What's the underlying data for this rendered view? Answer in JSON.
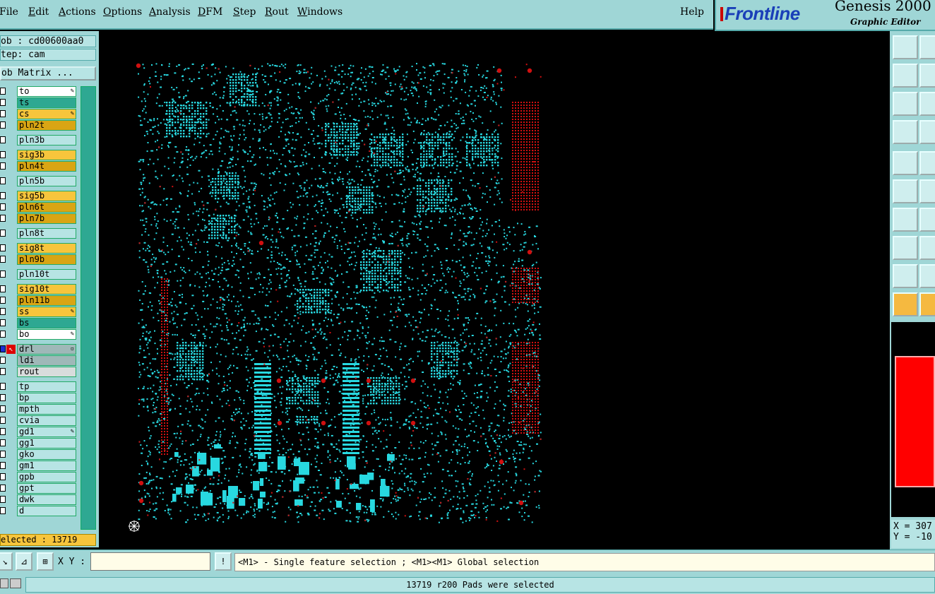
{
  "menu": {
    "items": [
      "File",
      "Edit",
      "Actions",
      "Options",
      "Analysis",
      "DFM",
      "Step",
      "Rout",
      "Windows"
    ],
    "help": "Help"
  },
  "brand": {
    "logo": "Frontline",
    "product": "Genesis 2000 -",
    "subtitle": "Graphic Editor"
  },
  "job": {
    "job_line": "ob : cd00600aa0",
    "step_line": "tep: cam",
    "matrix_button": "ob Matrix ..."
  },
  "layers": [
    {
      "name": "to",
      "color": "#ffffff",
      "mark": "✎"
    },
    {
      "name": "ts",
      "color": "#2ea892",
      "mark": ""
    },
    {
      "name": "cs",
      "color": "#f7c53c",
      "mark": "✎"
    },
    {
      "name": "pln2t",
      "color": "#d9a514",
      "mark": ""
    },
    {
      "name": "pln3b",
      "color": "#b7e4e4",
      "mark": ""
    },
    {
      "name": "sig3b",
      "color": "#f7c53c",
      "mark": ""
    },
    {
      "name": "pln4t",
      "color": "#d9a514",
      "mark": ""
    },
    {
      "name": "pln5b",
      "color": "#b7e4e4",
      "mark": ""
    },
    {
      "name": "sig5b",
      "color": "#f7c53c",
      "mark": ""
    },
    {
      "name": "pln6t",
      "color": "#d9a514",
      "mark": ""
    },
    {
      "name": "pln7b",
      "color": "#d9a514",
      "mark": ""
    },
    {
      "name": "pln8t",
      "color": "#b7e4e4",
      "mark": ""
    },
    {
      "name": "sig8t",
      "color": "#f7c53c",
      "mark": ""
    },
    {
      "name": "pln9b",
      "color": "#d9a514",
      "mark": ""
    },
    {
      "name": "pln10t",
      "color": "#b7e4e4",
      "mark": ""
    },
    {
      "name": "sig10t",
      "color": "#f7c53c",
      "mark": ""
    },
    {
      "name": "pln11b",
      "color": "#d9a514",
      "mark": ""
    },
    {
      "name": "ss",
      "color": "#f7c53c",
      "mark": "✎"
    },
    {
      "name": "bs",
      "color": "#2ea892",
      "mark": ""
    },
    {
      "name": "bo",
      "color": "#ffffff",
      "mark": "✎"
    },
    {
      "name": "drl",
      "color": "#9fb8b8",
      "mark": "▫",
      "active": true
    },
    {
      "name": "ldi",
      "color": "#9fb8b8",
      "mark": ""
    },
    {
      "name": "rout",
      "color": "#d8dcdc",
      "mark": ""
    },
    {
      "name": "tp",
      "color": "#b7e4e4",
      "mark": ""
    },
    {
      "name": "bp",
      "color": "#b7e4e4",
      "mark": ""
    },
    {
      "name": "mpth",
      "color": "#b7e4e4",
      "mark": ""
    },
    {
      "name": "cvia",
      "color": "#b7e4e4",
      "mark": ""
    },
    {
      "name": "gd1",
      "color": "#b7e4e4",
      "mark": "✎"
    },
    {
      "name": "gg1",
      "color": "#b7e4e4",
      "mark": ""
    },
    {
      "name": "gko",
      "color": "#b7e4e4",
      "mark": ""
    },
    {
      "name": "gm1",
      "color": "#b7e4e4",
      "mark": ""
    },
    {
      "name": "gpb",
      "color": "#b7e4e4",
      "mark": ""
    },
    {
      "name": "gpt",
      "color": "#b7e4e4",
      "mark": ""
    },
    {
      "name": "dwk",
      "color": "#b7e4e4",
      "mark": ""
    },
    {
      "name": "d",
      "color": "#b7e4e4",
      "mark": ""
    }
  ],
  "selected_label": "elected : 13719",
  "coords": {
    "x": "X = 307",
    "y": "Y = -10"
  },
  "bottom": {
    "xy_label": "X Y :",
    "xy_value": "",
    "hint": "<M1> - Single feature selection ; <M1><M1> Global selection"
  },
  "status": "13719 r200 Pads were selected",
  "colors": {
    "panel": "#9fd6d6",
    "pads": "#28d8e0",
    "red_pads": "#d01010"
  }
}
